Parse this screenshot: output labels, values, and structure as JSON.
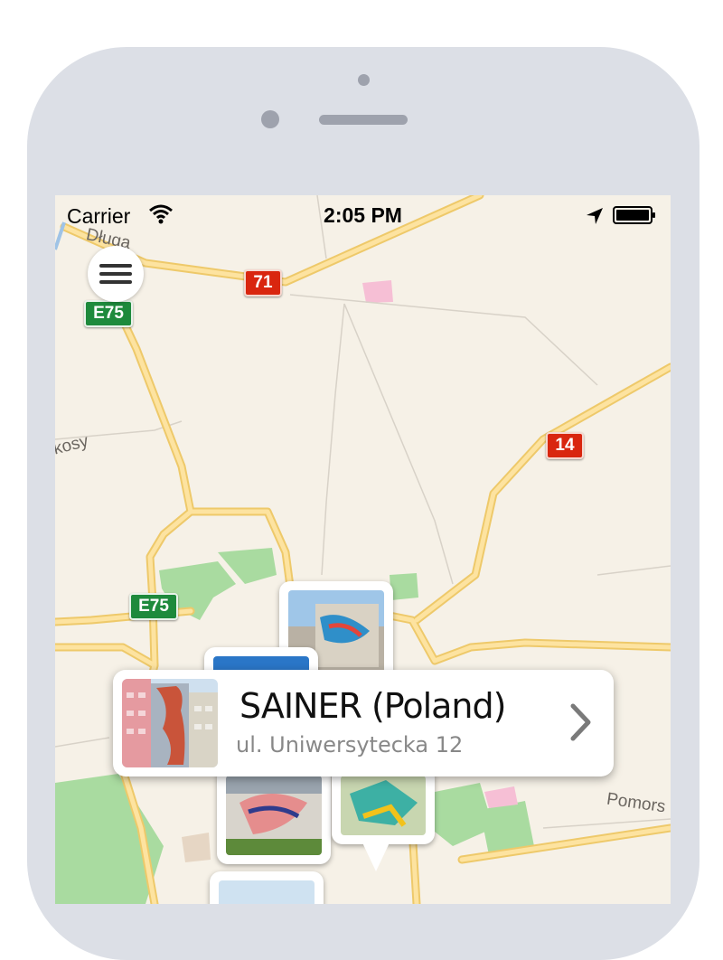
{
  "status_bar": {
    "carrier": "Carrier",
    "time": "2:05 PM"
  },
  "map": {
    "labels": {
      "dluga": "Długa",
      "kosy": "kosy",
      "pomors": "Pomors"
    },
    "shields": {
      "e75_top": "E75",
      "e75_mid": "E75",
      "r71": "71",
      "r14": "14"
    }
  },
  "callout": {
    "title": "SAINER (Poland)",
    "address": "ul. Uniwersytecka 12"
  },
  "icons": [
    "menu-icon",
    "wifi-icon",
    "location-arrow-icon",
    "battery-icon",
    "chevron-right-icon"
  ],
  "colors": {
    "map_bg": "#f6f1e7",
    "road": "#fcd878",
    "park": "#a9dba0",
    "device": "#dcdfe6"
  }
}
